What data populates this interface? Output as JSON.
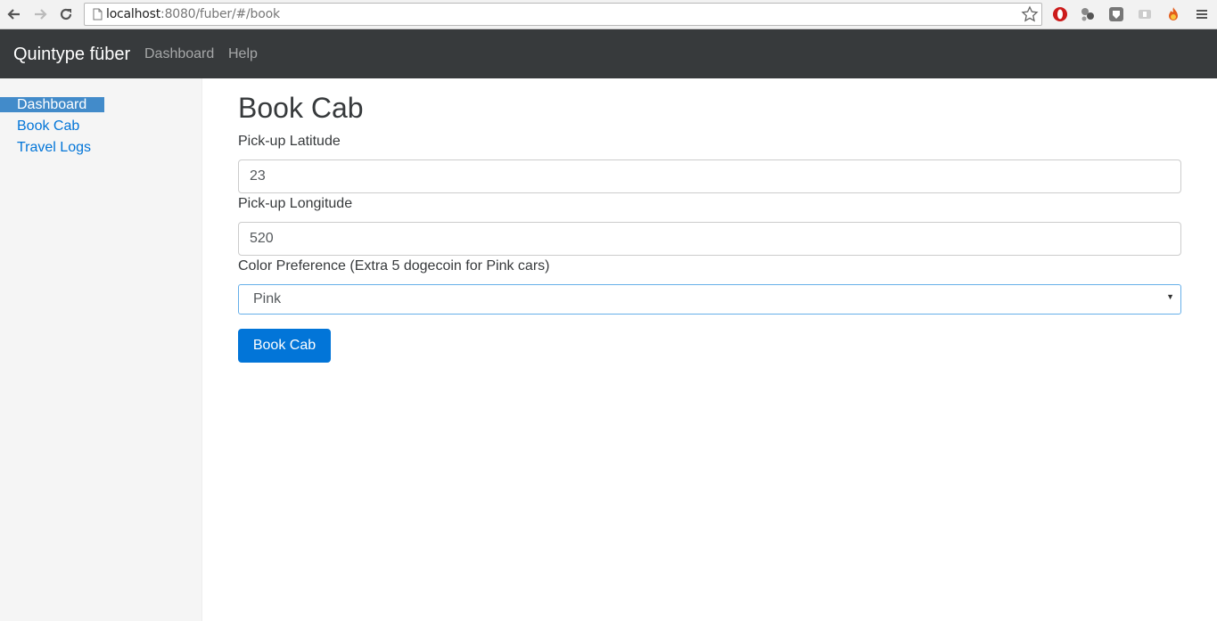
{
  "browser": {
    "url_host": "localhost",
    "url_rest": ":8080/fuber/#/book"
  },
  "navbar": {
    "brand": "Quintype füber",
    "links": [
      "Dashboard",
      "Help"
    ]
  },
  "sidebar": {
    "items": [
      {
        "label": "Dashboard",
        "active": true
      },
      {
        "label": "Book Cab",
        "active": false
      },
      {
        "label": "Travel Logs",
        "active": false
      }
    ]
  },
  "main": {
    "title": "Book Cab",
    "latitude": {
      "label": "Pick-up Latitude",
      "value": "23"
    },
    "longitude": {
      "label": "Pick-up Longitude",
      "value": "520"
    },
    "color": {
      "label": "Color Preference (Extra 5 dogecoin for Pink cars)",
      "value": "Pink"
    },
    "submit_label": "Book Cab"
  },
  "colors": {
    "navbar_bg": "#373a3c",
    "primary": "#0275d8",
    "sidebar_active": "#428bca",
    "sidebar_bg": "#f5f5f5"
  }
}
